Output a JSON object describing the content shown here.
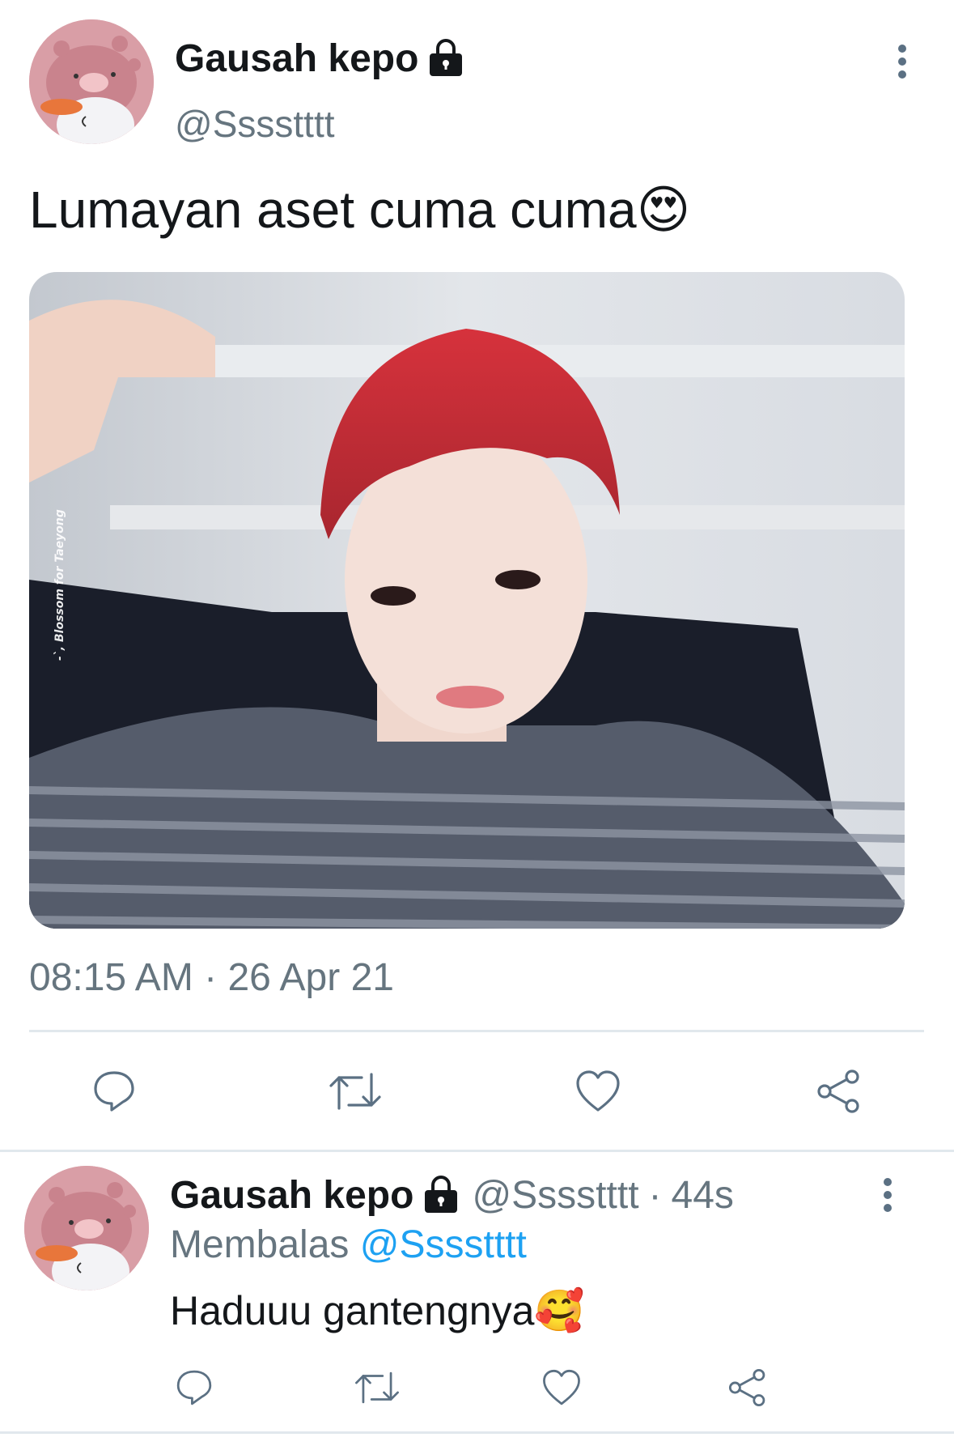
{
  "main_tweet": {
    "author_name": "Gausah kepo",
    "author_handle": "@Sssstttt",
    "text": "Lumayan aset cuma cuma",
    "emoji": "😍",
    "photo_watermark": "-`, Blossom for Taeyong",
    "timestamp": "08:15 AM · 26 Apr 21"
  },
  "reply_tweet": {
    "author_name": "Gausah kepo",
    "author_handle": "@Sssstttt",
    "separator": "·",
    "age": "44s",
    "replying_label": "Membalas",
    "replying_to": "@Sssstttt",
    "text": "Haduuu gantengnya",
    "emoji": "🥰"
  },
  "icons": {
    "lock": "lock-icon",
    "more": "more-vertical-icon",
    "reply": "reply-icon",
    "retweet": "retweet-icon",
    "like": "heart-icon",
    "share": "share-icon"
  },
  "colors": {
    "text": "#14171a",
    "muted": "#66757f",
    "link": "#1da1f2",
    "icon": "#5b7083",
    "divider": "#e1e8ed"
  }
}
